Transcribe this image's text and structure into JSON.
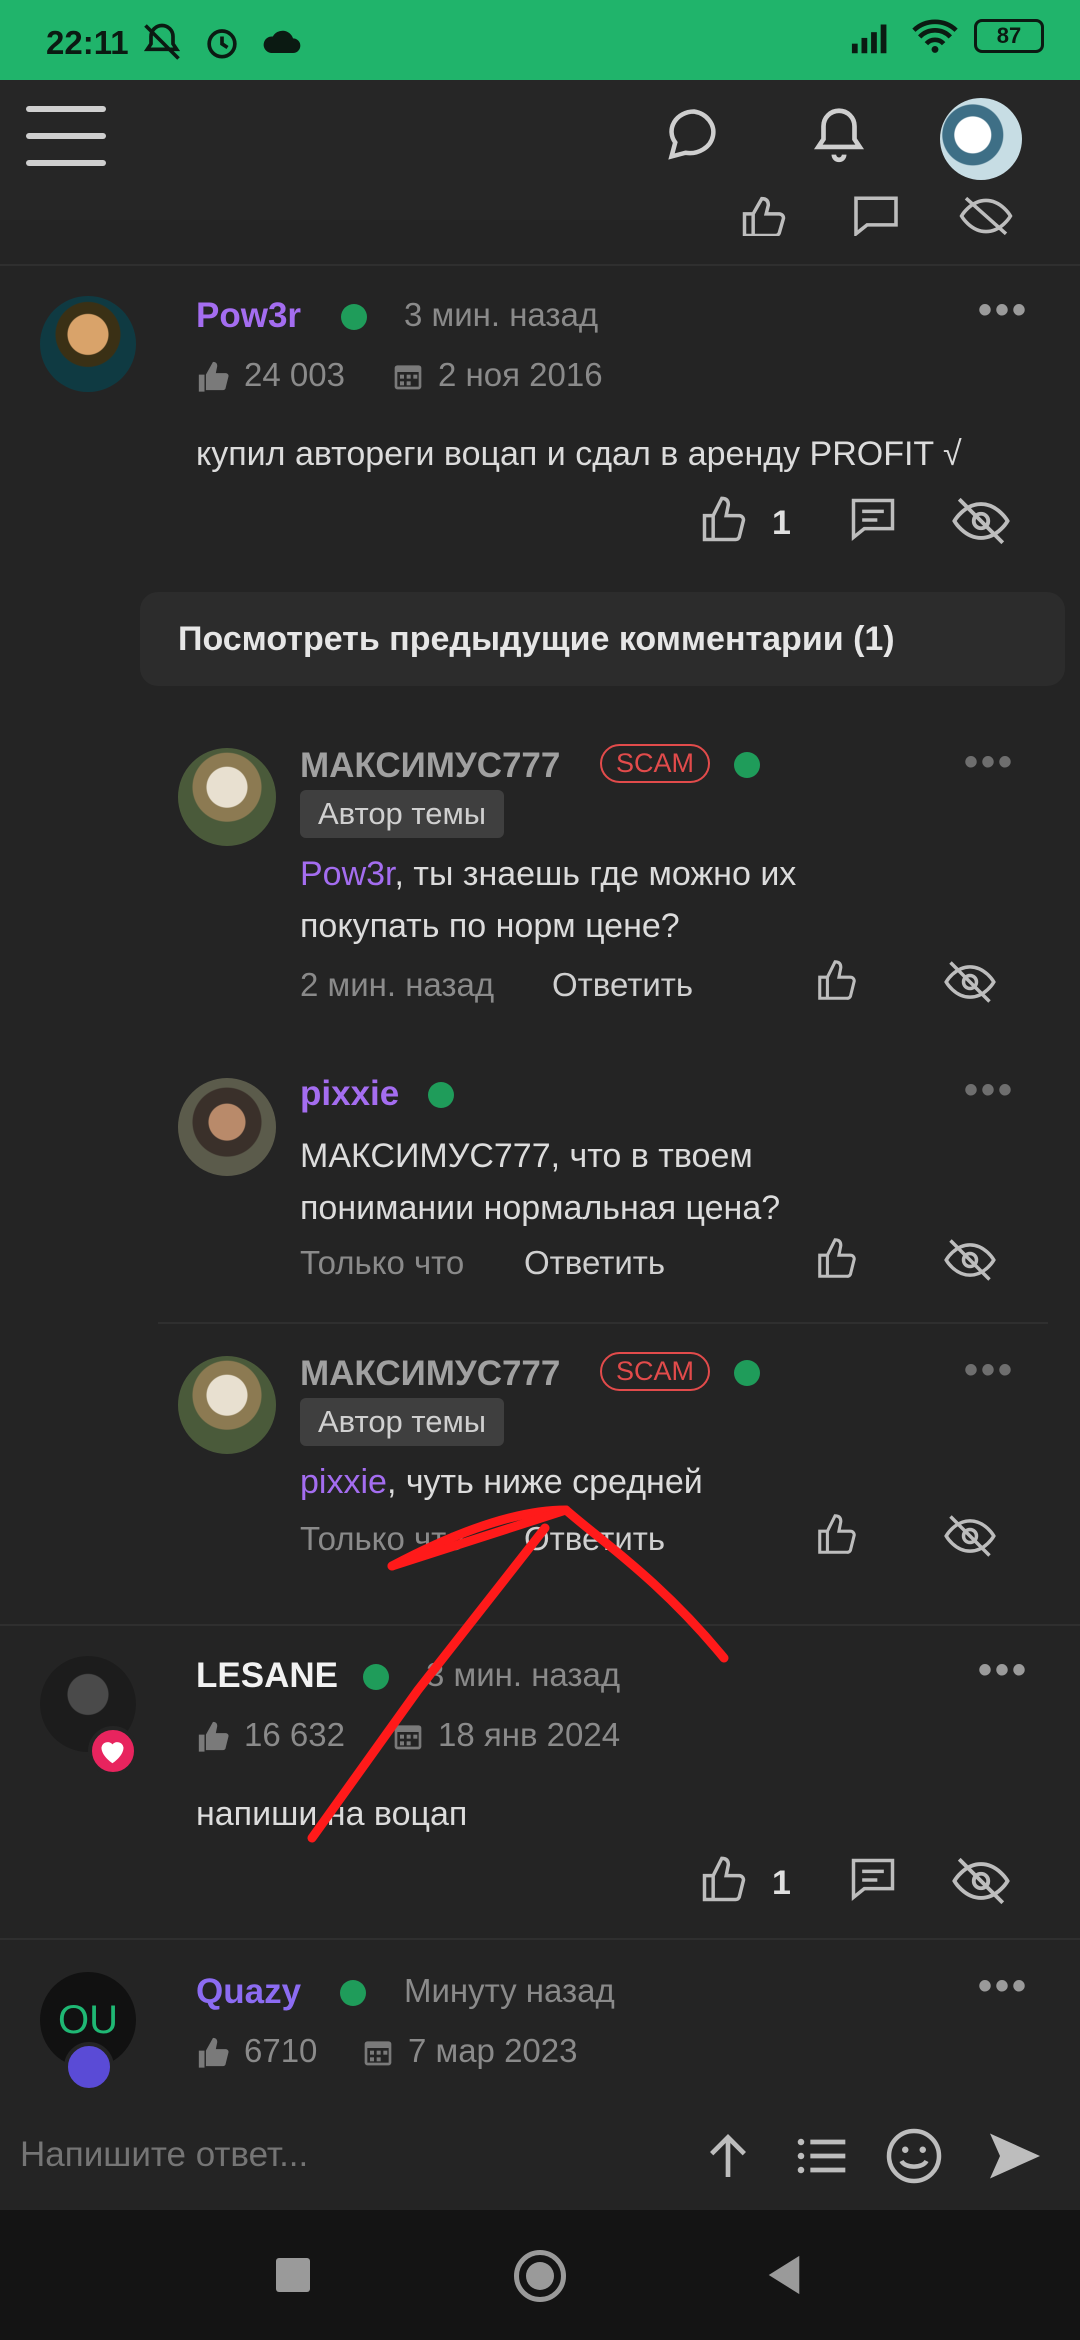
{
  "status_bar": {
    "time": "22:11",
    "battery": "87"
  },
  "posts": [
    {
      "name": "Pow3r",
      "time": "3 мин. назад",
      "likes": "24 003",
      "date": "2 ноя 2016",
      "text": "купил автореги воцап и сдал в аренду PROFIT √",
      "like_count": "1"
    },
    {
      "name": "LESANE",
      "time": "3 мин. назад",
      "likes": "16 632",
      "date": "18 янв 2024",
      "text": "напиши на воцап",
      "like_count": "1"
    },
    {
      "name": "Quazy",
      "time": "Минуту назад",
      "likes": "6710",
      "date": "7 мар 2023",
      "avatar_text": "OU"
    }
  ],
  "prev_comments": "Посмотреть предыдущие комментарии (1)",
  "comments": [
    {
      "name": "МАКСИМУС777",
      "scam": "SCAM",
      "badge": "Автор темы",
      "mention": "Pow3r",
      "text_line1": ", ты знаешь где можно их",
      "text_line2": "покупать по норм цене?",
      "time": "2 мин. назад",
      "reply": "Ответить"
    },
    {
      "name": "pixxie",
      "text_line1": "МАКСИМУС777, что в твоем",
      "text_line2": "понимании нормальная цена?",
      "time": "Только что",
      "reply": "Ответить"
    },
    {
      "name": "МАКСИМУС777",
      "scam": "SCAM",
      "badge": "Автор темы",
      "mention": "pixxie",
      "text_line1": ", чуть ниже средней",
      "time": "Только что",
      "reply": "Ответить"
    }
  ],
  "reply_input": {
    "placeholder": "Напишите ответ..."
  },
  "colors": {
    "accent_green": "#20b46b",
    "username_purple": "#a46df0",
    "scam_red": "#e24b4b",
    "annotation_red": "#ff1a1a"
  }
}
